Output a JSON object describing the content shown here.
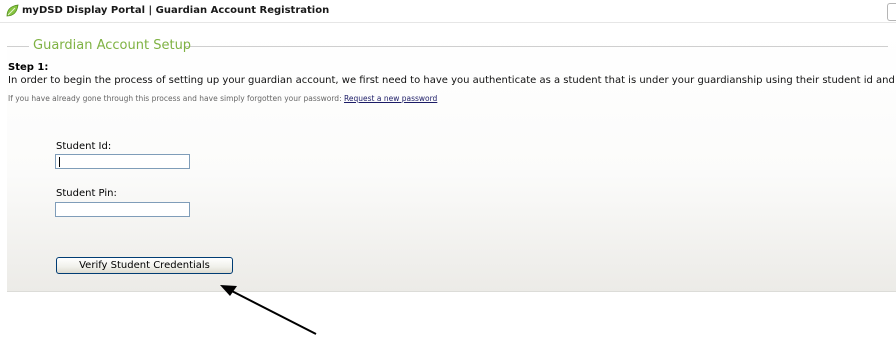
{
  "window": {
    "title": "myDSD Display Portal | Guardian Account Registration",
    "logo_icon": "green-leaf-icon"
  },
  "form": {
    "legend": "Guardian Account Setup",
    "step_label": "Step 1:",
    "description": "In order to begin the process of setting up your guardian account, we first need to have you authenticate as a student that is under your guardianship using their student id and pin.",
    "forgot_text": "If you have already gone through this process and have simply forgotten your password:",
    "forgot_link": "Request a new password",
    "student_id_label": "Student Id:",
    "student_id_value": "",
    "student_pin_label": "Student Pin:",
    "student_pin_value": "",
    "verify_button": "Verify Student Credentials"
  },
  "annotation": {
    "arrow_icon": "pointer-arrow-icon"
  },
  "colors": {
    "legend": "#7fb243",
    "link": "#1b1b66",
    "input_border": "#7f9db9",
    "button_border": "#003c74"
  }
}
